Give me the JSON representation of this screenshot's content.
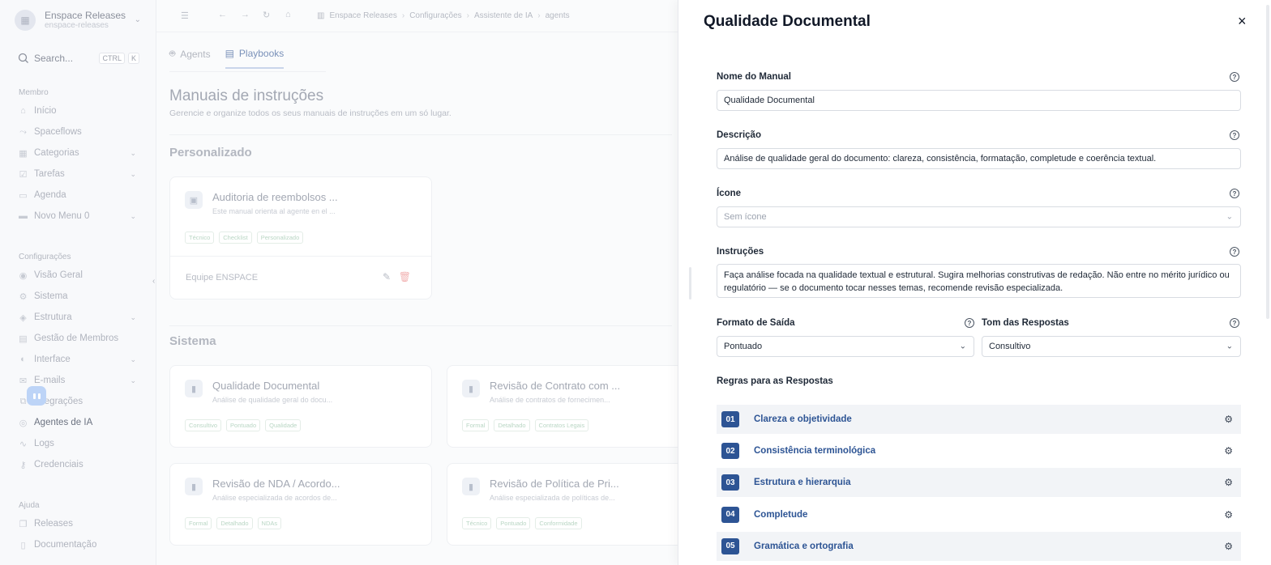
{
  "workspace": {
    "name": "Enspace Releases",
    "slug": "enspace-releases"
  },
  "search": {
    "label": "Search...",
    "kbd1": "CTRL",
    "kbd2": "K"
  },
  "sidebar": {
    "member_title": "Membro",
    "member_items": [
      {
        "label": "Início",
        "icon": "home-icon"
      },
      {
        "label": "Spaceflows",
        "icon": "flow-icon"
      },
      {
        "label": "Categorias",
        "icon": "grid-icon",
        "expandable": true
      },
      {
        "label": "Tarefas",
        "icon": "tasks-icon",
        "expandable": true
      },
      {
        "label": "Agenda",
        "icon": "calendar-icon"
      },
      {
        "label": "Novo Menu 0",
        "icon": "menu-icon",
        "expandable": true
      }
    ],
    "config_title": "Configurações",
    "config_items": [
      {
        "label": "Visão Geral",
        "icon": "overview-icon"
      },
      {
        "label": "Sistema",
        "icon": "gear-icon"
      },
      {
        "label": "Estrutura",
        "icon": "structure-icon",
        "expandable": true
      },
      {
        "label": "Gestão de Membros",
        "icon": "members-icon"
      },
      {
        "label": "Interface",
        "icon": "interface-icon",
        "expandable": true
      },
      {
        "label": "E-mails",
        "icon": "mail-icon",
        "expandable": true
      },
      {
        "label": "Integrações",
        "icon": "integrations-icon"
      },
      {
        "label": "Agentes de IA",
        "icon": "ai-agent-icon"
      },
      {
        "label": "Logs",
        "icon": "logs-icon"
      },
      {
        "label": "Credenciais",
        "icon": "key-icon"
      }
    ],
    "help_title": "Ajuda",
    "help_items": [
      {
        "label": "Releases",
        "icon": "releases-icon"
      },
      {
        "label": "Documentação",
        "icon": "docs-icon"
      }
    ]
  },
  "breadcrumb": [
    "Enspace Releases",
    "Configurações",
    "Assistente de IA",
    "agents"
  ],
  "tabs": [
    {
      "label": "Agents",
      "icon": "robot-icon"
    },
    {
      "label": "Playbooks",
      "icon": "book-icon"
    }
  ],
  "page": {
    "title": "Manuais de instruções",
    "subtitle": "Gerencie e organize todos os seus manuais de instruções em um só lugar.",
    "custom_title": "Personalizado",
    "system_title": "Sistema"
  },
  "custom_card": {
    "title": "Auditoria de reembolsos ...",
    "desc": "Este manual orienta al agente en el ...",
    "tags": [
      "Técnico",
      "Checklist",
      "Personalizado"
    ],
    "team": "Equipe ENSPACE"
  },
  "system_cards": [
    {
      "title": "Qualidade Documental",
      "desc": "Análise de qualidade geral do docu...",
      "tags": [
        "Consultivo",
        "Pontuado",
        "Qualidade"
      ]
    },
    {
      "title": "Revisão de Contrato com ...",
      "desc": "Análise de contratos de fornecimen...",
      "tags": [
        "Formal",
        "Detalhado",
        "Contratos Legais"
      ]
    },
    {
      "title": "Revisão de NDA / Acordo...",
      "desc": "Análise especializada de acordos de...",
      "tags": [
        "Formal",
        "Detalhado",
        "NDAs"
      ]
    },
    {
      "title": "Revisão de Política de Pri...",
      "desc": "Análise especializada de políticas de...",
      "tags": [
        "Técnico",
        "Pontuado",
        "Conformidade"
      ]
    }
  ],
  "panel": {
    "title": "Qualidade Documental",
    "close": "×",
    "name_label": "Nome do Manual",
    "name_value": "Qualidade Documental",
    "desc_label": "Descrição",
    "desc_value": "Análise de qualidade geral do documento: clareza, consistência, formatação, completude e coerência textual.",
    "icon_label": "Ícone",
    "icon_placeholder": "Sem ícone",
    "instr_label": "Instruções",
    "instr_value": "Faça análise focada na qualidade textual e estrutural. Sugira melhorias construtivas de redação. Não entre no mérito jurídico ou regulatório — se o documento tocar nesses temas, recomende revisão especializada.",
    "format_label": "Formato de Saída",
    "format_value": "Pontuado",
    "tone_label": "Tom das Respostas",
    "tone_value": "Consultivo",
    "rules_title": "Regras para as Respostas",
    "rules": [
      {
        "num": "01",
        "label": "Clareza e objetividade"
      },
      {
        "num": "02",
        "label": "Consistência terminológica"
      },
      {
        "num": "03",
        "label": "Estrutura e hierarquia"
      },
      {
        "num": "04",
        "label": "Completude"
      },
      {
        "num": "05",
        "label": "Gramática e ortografia"
      }
    ]
  }
}
